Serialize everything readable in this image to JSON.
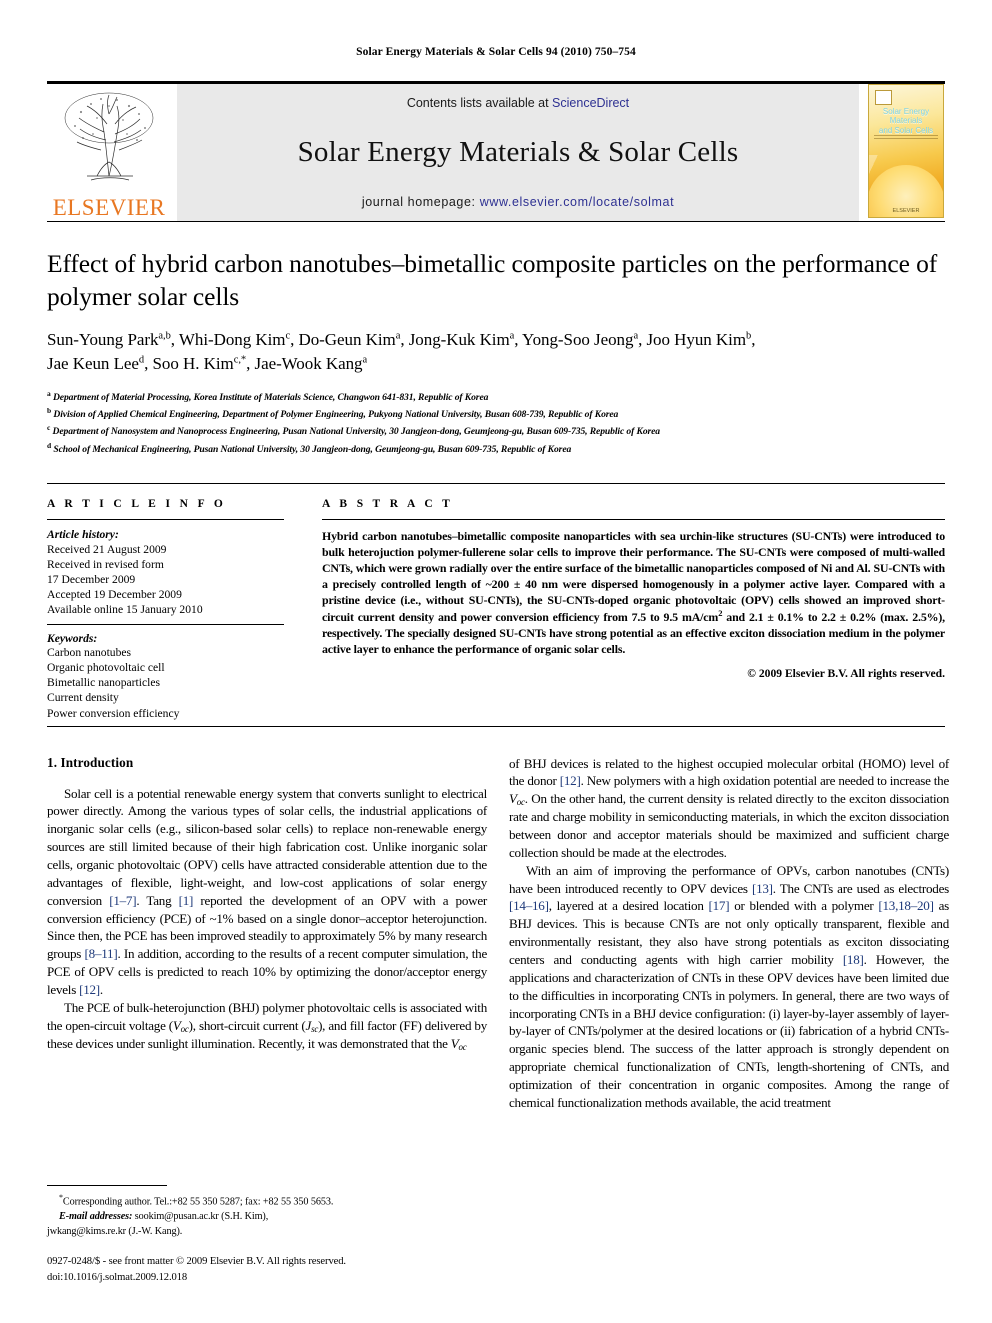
{
  "running_head": "Solar Energy Materials & Solar Cells 94 (2010) 750–754",
  "masthead": {
    "publisher_wordmark": "ELSEVIER",
    "contents_prefix": "Contents lists available at ",
    "contents_link": "ScienceDirect",
    "journal_title": "Solar Energy Materials & Solar Cells",
    "homepage_label": "journal homepage: ",
    "homepage_url": "www.elsevier.com/locate/solmat",
    "cover": {
      "title_line1": "Solar Energy Materials",
      "title_line2": "and Solar Cells",
      "footer": "ELSEVIER"
    },
    "link_color": "#2e3192",
    "wordmark_color": "#E87722"
  },
  "article": {
    "title": "Effect of hybrid carbon nanotubes–bimetallic composite particles on the performance of polymer solar cells",
    "authors_line1": "Sun-Young Park a,b, Whi-Dong Kim c, Do-Geun Kim a, Jong-Kuk Kim a, Yong-Soo Jeong a, Joo Hyun Kim b,",
    "authors_line2": "Jae Keun Lee d, Soo H. Kim c,*, Jae-Wook Kang a",
    "affiliations": [
      {
        "mark": "a",
        "text": "Department of Material Processing, Korea Institute of Materials Science, Changwon 641-831, Republic of Korea"
      },
      {
        "mark": "b",
        "text": "Division of Applied Chemical Engineering, Department of Polymer Engineering, Pukyong National University, Busan 608-739, Republic of Korea"
      },
      {
        "mark": "c",
        "text": "Department of Nanosystem and Nanoprocess Engineering, Pusan National University, 30 Jangjeon-dong, Geumjeong-gu, Busan 609-735, Republic of Korea"
      },
      {
        "mark": "d",
        "text": "School of Mechanical Engineering, Pusan National University, 30 Jangjeon-dong, Geumjeong-gu, Busan 609-735, Republic of Korea"
      }
    ]
  },
  "article_info": {
    "heading": "A R T I C L E   I N F O",
    "history_label": "Article history:",
    "history": [
      "Received 21 August 2009",
      "Received in revised form",
      "17 December 2009",
      "Accepted 19 December 2009",
      "Available online 15 January 2010"
    ],
    "keywords_label": "Keywords:",
    "keywords": [
      "Carbon nanotubes",
      "Organic photovoltaic cell",
      "Bimetallic nanoparticles",
      "Current density",
      "Power conversion efficiency"
    ]
  },
  "abstract": {
    "heading": "A B S T R A C T",
    "text_part1": "Hybrid carbon nanotubes–bimetallic composite nanoparticles with sea urchin-like structures (SU-CNTs) were introduced to bulk heterojuction polymer-fullerene solar cells to improve their performance. The SU-CNTs were composed of multi-walled CNTs, which were grown radially over the entire surface of the bimetallic nanoparticles composed of Ni and Al. SU-CNTs with a precisely controlled length of ~200 ± 40 nm were dispersed homogenously in a polymer active layer. Compared with a pristine device (i.e., without SU-CNTs), the SU-CNTs-doped organic photovoltaic (OPV) cells showed an improved short-circuit current density and power conversion efficiency from 7.5 to 9.5 mA/cm",
    "superscript": "2",
    "text_part2": " and 2.1 ± 0.1% to 2.2 ± 0.2% (max. 2.5%), respectively. The specially designed SU-CNTs have strong potential as an effective exciton dissociation medium in the polymer active layer to enhance the performance of organic solar cells.",
    "copyright": "© 2009 Elsevier B.V. All rights reserved."
  },
  "introduction": {
    "heading": "1.  Introduction",
    "left_paragraph_1_a": "Solar cell is a potential renewable energy system that converts sunlight to electrical power directly. Among the various types of solar cells, the industrial applications of inorganic solar cells (e.g., silicon-based solar cells) to replace non-renewable energy sources are still limited because of their high fabrication cost. Unlike inorganic solar cells, organic photovoltaic (OPV) cells have attracted considerable attention due to the advantages of flexible, light-weight, and low-cost applications of solar energy conversion ",
    "ref_1_7": "[1–7]",
    "left_paragraph_1_b": ". Tang ",
    "ref_1": "[1]",
    "left_paragraph_1_c": " reported the development of an OPV with a power conversion efficiency (PCE) of ~1% based on a single donor–acceptor heterojunction. Since then, the PCE has been improved steadily to approximately 5% by many research groups ",
    "ref_8_11": "[8–11]",
    "left_paragraph_1_d": ". In addition, according to the results of a recent computer simulation, the PCE of OPV cells is predicted to reach 10% by optimizing the donor/acceptor energy levels ",
    "ref_12": "[12]",
    "left_paragraph_1_e": ".",
    "left_paragraph_2_a": "The PCE of bulk-heterojunction (BHJ) polymer photovoltaic cells is associated with the open-circuit voltage (",
    "voc": "V",
    "voc_sub": "oc",
    "left_paragraph_2_b": "), short-circuit current (",
    "jsc": "J",
    "jsc_sub": "sc",
    "left_paragraph_2_c": "), and fill factor (FF) delivered by these devices under sunlight illumination. Recently, it was demonstrated that the ",
    "left_paragraph_2_end": "",
    "right_paragraph_1_a": "of BHJ devices is related to the highest occupied molecular orbital (HOMO) level of the donor ",
    "right_ref_12": "[12]",
    "right_paragraph_1_b": ". New polymers with a high oxidation potential are needed to increase the ",
    "right_paragraph_1_c": ". On the other hand, the current density is related directly to the exciton dissociation rate and charge mobility in semiconducting materials, in which the exciton dissociation between donor and acceptor materials should be maximized and sufficient charge collection should be made at the electrodes.",
    "right_paragraph_2_a": "With an aim of improving the performance of OPVs, carbon nanotubes (CNTs) have been introduced recently to OPV devices ",
    "ref_13": "[13]",
    "right_paragraph_2_b": ". The CNTs are used as electrodes ",
    "ref_14_16": "[14–16]",
    "right_paragraph_2_c": ", layered at a desired location ",
    "ref_17": "[17]",
    "right_paragraph_2_d": " or blended with a polymer ",
    "ref_13_18_20": "[13,18–20]",
    "right_paragraph_2_e": " as BHJ devices. This is because CNTs are not only optically transparent, flexible and environmentally resistant, they also have strong potentials as exciton dissociating centers and conducting agents with high carrier mobility ",
    "ref_18": "[18]",
    "right_paragraph_2_f": ". However, the applications and characterization of CNTs in these OPV devices have been limited due to the difficulties in incorporating CNTs in polymers. In general, there are two ways of incorporating CNTs in a BHJ device configuration: (i) layer-by-layer assembly of layer-by-layer of CNTs/polymer at the desired locations or (ii) fabrication of a hybrid CNTs-organic species blend. The success of the latter approach is strongly dependent on appropriate chemical functionalization of CNTs, length-shortening of CNTs, and optimization of their concentration in organic composites. Among the range of chemical functionalization methods available, the acid treatment",
    "ref_color": "#1f3a7a"
  },
  "footnotes": {
    "corresponding": "Corresponding author. Tel.:+82 55 350 5287; fax: +82 55 350 5653.",
    "email_label": "E-mail addresses:",
    "email_1": " sookim@pusan.ac.kr (S.H. Kim),",
    "email_2": "jwkang@kims.re.kr (J.-W. Kang).",
    "imprint_line1": "0927-0248/$ - see front matter © 2009 Elsevier B.V. All rights reserved.",
    "imprint_line2": "doi:10.1016/j.solmat.2009.12.018"
  }
}
